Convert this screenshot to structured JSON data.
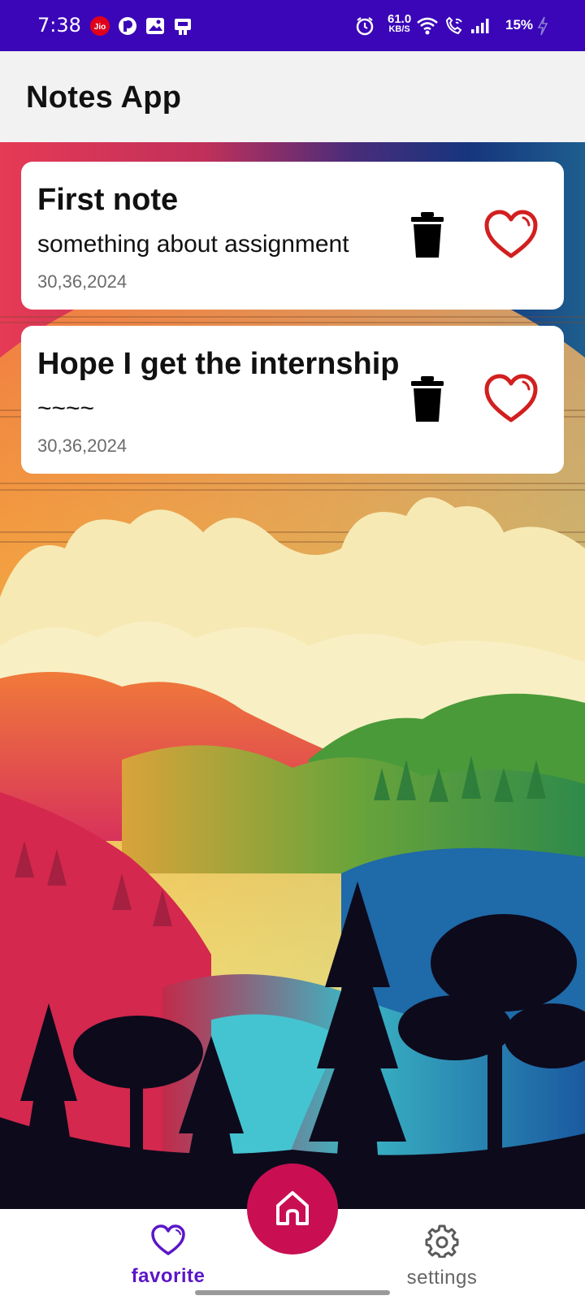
{
  "status_bar": {
    "time": "7:38",
    "carrier_badge": "Jio",
    "network_speed_value": "61.0",
    "network_speed_unit": "KB/S",
    "battery": "15%",
    "icons": [
      "jio-icon",
      "notification-icon",
      "gallery-icon",
      "app-icon",
      "alarm-icon",
      "wifi-icon",
      "wifi-call-icon",
      "signal-icon",
      "battery-charging-icon"
    ],
    "background_color": "#3a06b8"
  },
  "app_bar": {
    "title": "Notes App"
  },
  "notes": [
    {
      "title": "First note",
      "body": "something about assignment",
      "date": "30,36,2024"
    },
    {
      "title": "Hope I get the internship",
      "body": "~~~~",
      "date": "30,36,2024"
    }
  ],
  "bottom_nav": {
    "favorite_label": "favorite",
    "settings_label": "settings",
    "center_icon": "home-icon",
    "active_color": "#5b16c8",
    "fab_color": "#c90f52"
  },
  "colors": {
    "heart": "#d21f1f"
  }
}
